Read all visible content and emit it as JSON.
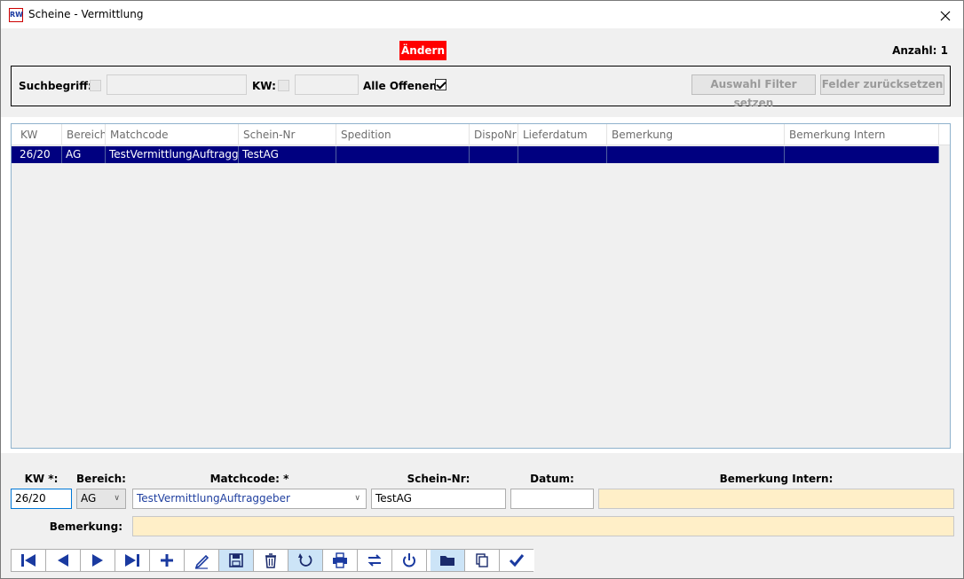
{
  "window": {
    "title": "Scheine - Vermittlung",
    "icon_text": "RW"
  },
  "header": {
    "mode_label": "Ändern",
    "count_label": "Anzahl: 1"
  },
  "filter": {
    "search_label": "Suchbegriff:",
    "search_enabled": false,
    "search_value": "",
    "kw_label": "KW:",
    "kw_enabled": false,
    "kw_value": "",
    "open_label": "Alle Offenen:",
    "open_checked": true,
    "apply_button": "Auswahl Filter setzen",
    "reset_button": "Felder zurücksetzen"
  },
  "grid": {
    "columns": [
      "KW",
      "Bereich",
      "Matchcode",
      "Schein-Nr",
      "Spedition",
      "DispoNr",
      "Lieferdatum",
      "Bemerkung",
      "Bemerkung Intern"
    ],
    "rows": [
      [
        "26/20",
        "AG",
        "TestVermittlungAuftraggeb",
        "TestAG",
        "",
        "",
        "",
        "",
        ""
      ]
    ]
  },
  "form": {
    "kw_label": "KW *:",
    "kw_value": "26/20",
    "bereich_label": "Bereich:",
    "bereich_value": "AG",
    "matchcode_label": "Matchcode: *",
    "matchcode_value": "TestVermittlungAuftraggeber",
    "schein_label": "Schein-Nr:",
    "schein_value": "TestAG",
    "datum_label": "Datum:",
    "datum_value": "",
    "bem_intern_label": "Bemerkung Intern:",
    "bem_intern_value": "",
    "bemerkung_label": "Bemerkung:",
    "bemerkung_value": ""
  },
  "toolbar": {
    "icons": [
      "first-record-icon",
      "previous-record-icon",
      "next-record-icon",
      "last-record-icon",
      "add-icon",
      "edit-pencil-icon",
      "save-icon",
      "delete-icon",
      "undo-icon",
      "print-icon",
      "swap-icon",
      "power-icon",
      "folder-icon",
      "copy-icon",
      "confirm-check-icon"
    ],
    "pressed": [
      "save-icon",
      "undo-icon",
      "folder-icon"
    ]
  },
  "colors": {
    "accent": "#000080",
    "mode_badge": "#ff0000",
    "note_field": "#ffefc8",
    "icon": "#1a3aa0"
  }
}
